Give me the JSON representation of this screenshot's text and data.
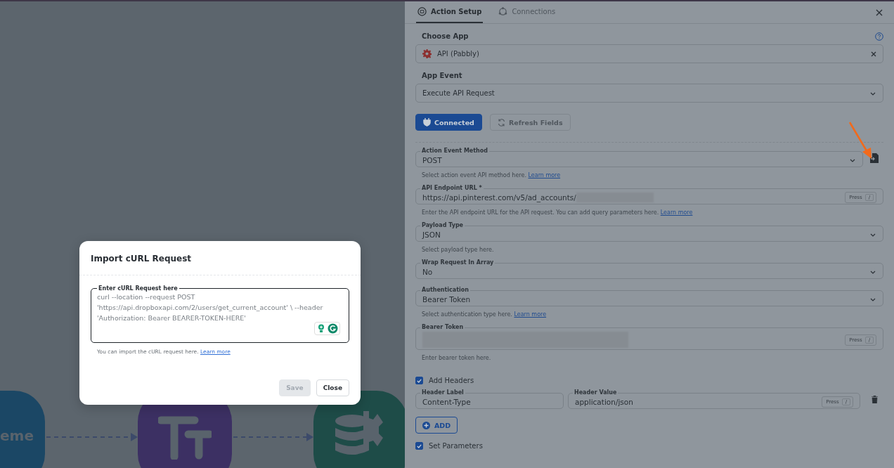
{
  "canvas": {
    "nodes": [
      {
        "kind": "text",
        "label": "eme"
      },
      {
        "kind": "formatter"
      },
      {
        "kind": "database"
      }
    ]
  },
  "modal": {
    "title": "Import cURL Request",
    "field": {
      "label": "Enter cURL Request here",
      "placeholder": "curl --location --request POST 'https://api.dropboxapi.com/2/users/get_current_account' \\ --header 'Authorization: Bearer BEARER-TOKEN-HERE'"
    },
    "help": "You can import the cURL request here.",
    "help_link": "Learn more",
    "buttons": [
      {
        "label": "Save",
        "disabled": true
      },
      {
        "label": "Close",
        "disabled": false
      }
    ]
  },
  "panel": {
    "tabs": [
      {
        "label": "Action Setup",
        "selected": true
      },
      {
        "label": "Connections",
        "selected": false
      }
    ],
    "choose_app": {
      "label": "Choose App",
      "value": "API (Pabbly)"
    },
    "app_event": {
      "label": "App Event",
      "value": "Execute API Request"
    },
    "buttons": [
      {
        "label": "Connected",
        "disabled": false
      },
      {
        "label": "Refresh Fields",
        "disabled": true
      }
    ],
    "fields": [
      {
        "kind": "select",
        "label": "Action Event Method",
        "value": "POST",
        "help": "Select action event API method here.",
        "link": "Learn more",
        "import_button": true
      },
      {
        "kind": "input",
        "label": "API Endpoint URL *",
        "value": "https://api.pinterest.com/v5/ad_accounts/",
        "redacted": true,
        "shortcut": [
          "Press",
          "/"
        ],
        "help": "Enter the API endpoint URL for the API request. You can add query parameters here.",
        "link": "Learn more"
      },
      {
        "kind": "select",
        "label": "Payload Type",
        "value": "JSON",
        "help": "Select payload type here."
      },
      {
        "kind": "select",
        "label": "Wrap Request In Array",
        "value": "No"
      },
      {
        "kind": "select",
        "label": "Authentication",
        "value": "Bearer Token",
        "help": "Select authentication type here.",
        "link": "Learn more"
      },
      {
        "kind": "secret",
        "label": "Bearer Token",
        "redacted": true,
        "shortcut": [
          "Press",
          "/"
        ],
        "help": "Enter bearer token here."
      }
    ],
    "headers": {
      "label": "Add Headers",
      "checked": true,
      "rows": [
        {
          "label_title": "Header Label",
          "label_value": "Content-Type",
          "value_title": "Header Value",
          "value": "application/json",
          "shortcut": [
            "Press",
            "/"
          ]
        }
      ],
      "add": "ADD"
    },
    "parameters": {
      "label": "Set Parameters",
      "checked": true
    }
  }
}
